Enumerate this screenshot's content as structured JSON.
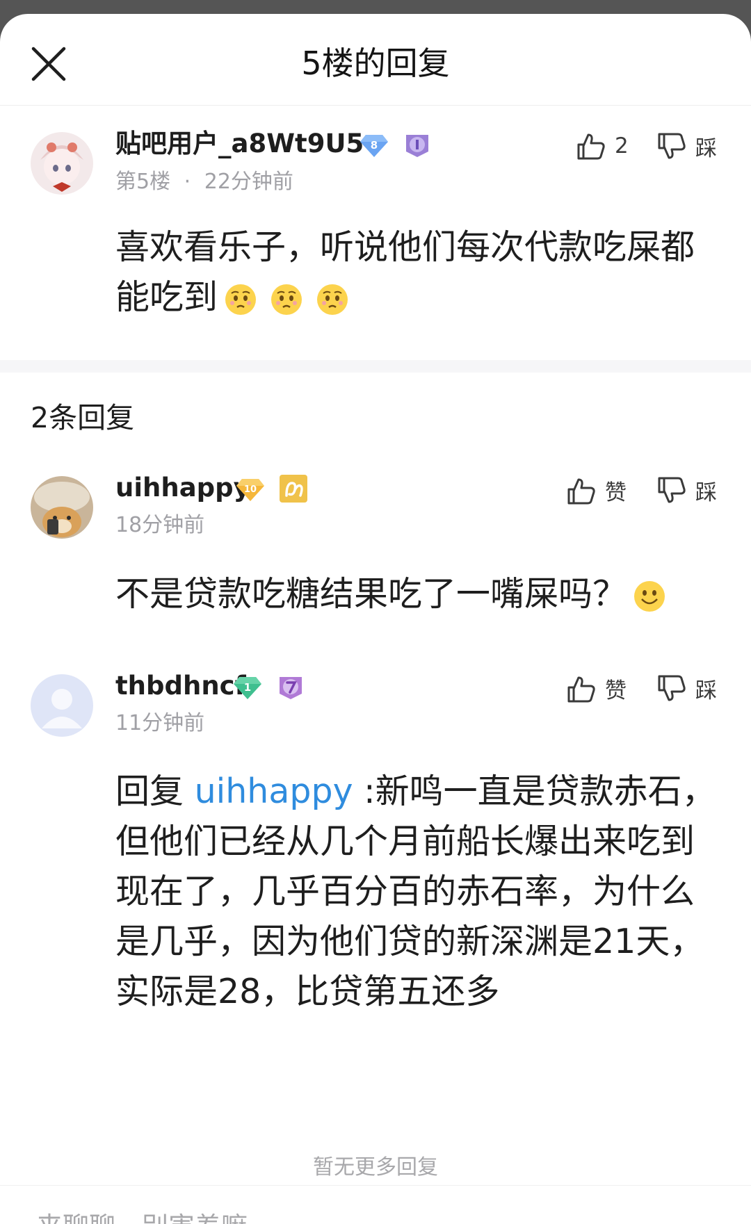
{
  "header": {
    "title": "5楼的回复"
  },
  "main_post": {
    "username": "贴吧用户_a8Wt9U5",
    "level_badge": "8",
    "floor": "第5楼",
    "separator": "·",
    "time": "22分钟前",
    "like_count": "2",
    "dislike_label": "踩",
    "content": "喜欢看乐子，听说他们每次代款吃屎都能吃到"
  },
  "replies_count": "2条回复",
  "replies": [
    {
      "username": "uihhappy",
      "level_badge": "10",
      "time": "18分钟前",
      "like_label": "赞",
      "dislike_label": "踩",
      "content": "不是贷款吃糖结果吃了一嘴屎吗？"
    },
    {
      "username": "thbdhncf",
      "level_badge": "1",
      "time": "11分钟前",
      "like_label": "赞",
      "dislike_label": "踩",
      "reply_prefix": "回复 ",
      "mention": "uihhappy",
      "content": " :新鸣一直是贷款赤石，但他们已经从几个月前船长爆出来吃到现在了，几乎百分百的赤石率，为什么是几乎，因为他们贷的新深渊是21天，实际是28，比贷第五还多"
    }
  ],
  "footer": {
    "no_more": "暂无更多回复",
    "input_placeholder": "来聊聊，别害羞嘛~"
  },
  "colors": {
    "mention": "#2f8cde",
    "meta": "#a0a0a5",
    "separator": "#f6f6f8"
  },
  "icons": [
    "close-icon",
    "thumbs-up-icon",
    "thumbs-down-icon",
    "diamond-badge-icon",
    "member-badge-icon",
    "emoji-icon"
  ]
}
